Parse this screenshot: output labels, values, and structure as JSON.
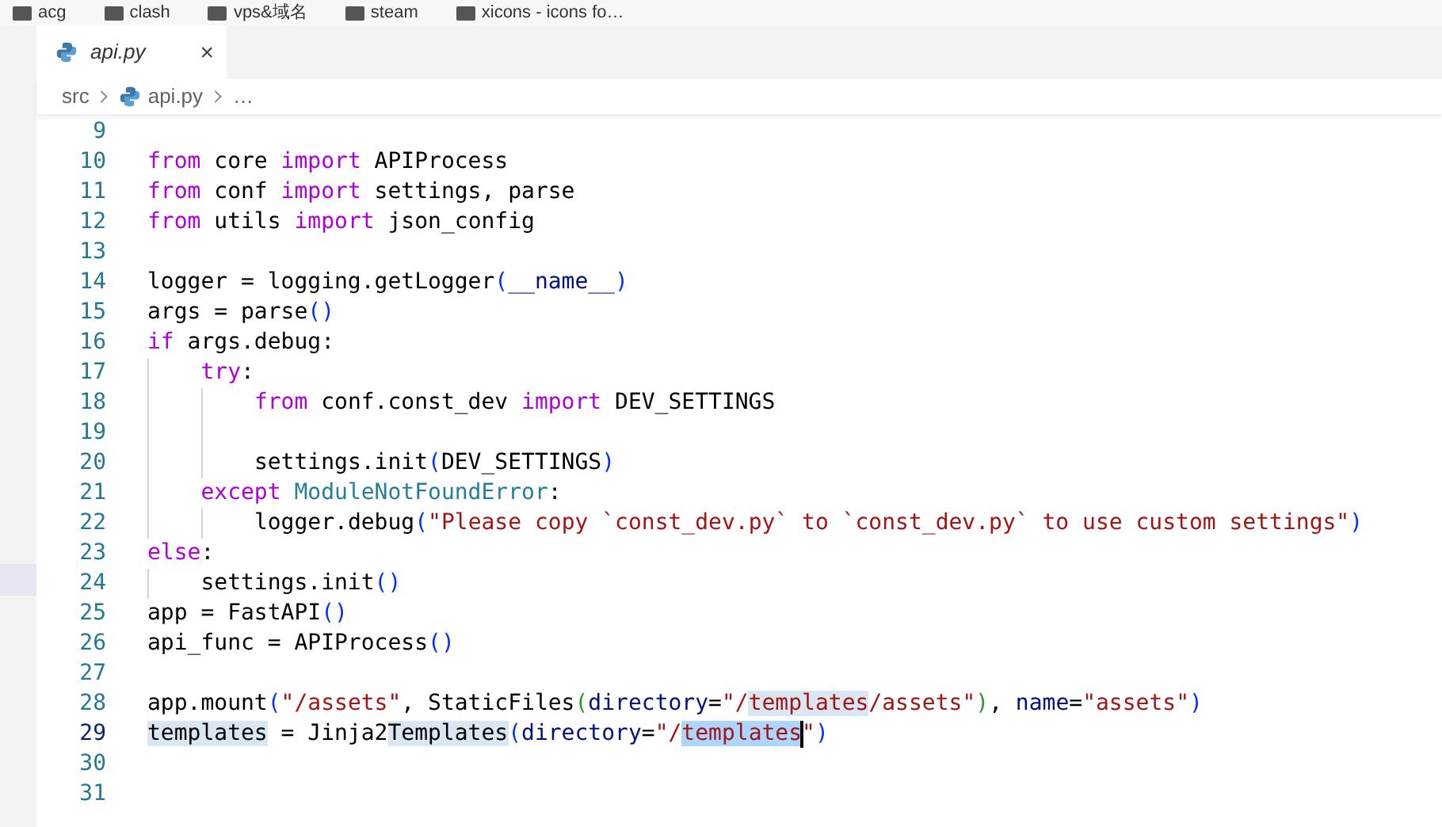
{
  "bookmarks": [
    {
      "label": "acg"
    },
    {
      "label": "clash"
    },
    {
      "label": "vps&域名"
    },
    {
      "label": "steam"
    },
    {
      "label": "xicons - icons fo…"
    }
  ],
  "tabs": [
    {
      "label": "api.py",
      "selected": true,
      "preview": true,
      "close": "×"
    }
  ],
  "breadcrumb": [
    {
      "label": "src",
      "kind": "folder"
    },
    {
      "label": "api.py",
      "kind": "file"
    },
    {
      "label": "…",
      "kind": "more"
    }
  ],
  "editor": {
    "lines": [
      {
        "number": "9",
        "current": false
      },
      {
        "number": "10",
        "current": false,
        "tokens": [
          {
            "t": "from",
            "kind": "kw"
          },
          {
            "t": " core ",
            "kind": "plain"
          },
          {
            "t": "import",
            "kind": "kw"
          },
          {
            "t": " APIProcess",
            "kind": "plain"
          }
        ]
      },
      {
        "number": "11",
        "current": false,
        "tokens": [
          {
            "t": "from",
            "kind": "kw"
          },
          {
            "t": " conf ",
            "kind": "plain"
          },
          {
            "t": "import",
            "kind": "kw"
          },
          {
            "t": " settings, parse",
            "kind": "plain"
          }
        ]
      },
      {
        "number": "12",
        "current": false,
        "tokens": [
          {
            "t": "from",
            "kind": "kw"
          },
          {
            "t": " utils ",
            "kind": "plain"
          },
          {
            "t": "import",
            "kind": "kw"
          },
          {
            "t": " json_config",
            "kind": "plain"
          }
        ]
      },
      {
        "number": "13",
        "current": false
      },
      {
        "number": "14",
        "current": false,
        "tokens": [
          {
            "t": "logger = logging.getLogger",
            "kind": "plain"
          },
          {
            "t": "(",
            "kind": "p1"
          },
          {
            "t": "__name__",
            "kind": "param"
          },
          {
            "t": ")",
            "kind": "p1"
          }
        ]
      },
      {
        "number": "15",
        "current": false,
        "tokens": [
          {
            "t": "args = parse",
            "kind": "plain"
          },
          {
            "t": "()",
            "kind": "p1"
          }
        ]
      },
      {
        "number": "16",
        "current": false,
        "tokens": [
          {
            "t": "if",
            "kind": "kw"
          },
          {
            "t": " args.debug:",
            "kind": "plain"
          }
        ],
        "children": [
          {
            "number": "17",
            "current": false,
            "tokens": [
              {
                "t": "try",
                "kind": "kw"
              },
              {
                "t": ":",
                "kind": "plain"
              }
            ],
            "children": [
              {
                "number": "18",
                "current": false,
                "tokens": [
                  {
                    "t": "from",
                    "kind": "kw"
                  },
                  {
                    "t": " conf.const_dev ",
                    "kind": "plain"
                  },
                  {
                    "t": "import",
                    "kind": "kw"
                  },
                  {
                    "t": " DEV_SETTINGS",
                    "kind": "plain"
                  }
                ]
              },
              {
                "number": "19",
                "current": false
              },
              {
                "number": "20",
                "current": false,
                "tokens": [
                  {
                    "t": "settings.init",
                    "kind": "plain"
                  },
                  {
                    "t": "(",
                    "kind": "p1"
                  },
                  {
                    "t": "DEV_SETTINGS",
                    "kind": "plain"
                  },
                  {
                    "t": ")",
                    "kind": "p1"
                  }
                ]
              }
            ]
          },
          {
            "number": "21",
            "current": false,
            "tokens": [
              {
                "t": "except",
                "kind": "kw"
              },
              {
                "t": " ModuleNotFoundError",
                "kind": "cls"
              },
              {
                "t": ":",
                "kind": "plain"
              }
            ],
            "children": [
              {
                "number": "22",
                "current": false,
                "tokens": [
                  {
                    "t": "logger.debug",
                    "kind": "plain"
                  },
                  {
                    "t": "(",
                    "kind": "p1"
                  },
                  {
                    "t": "\"Please copy `const_dev.py` to `const_dev.py` to use custom settings\"",
                    "kind": "str"
                  },
                  {
                    "t": ")",
                    "kind": "p1"
                  }
                ]
              }
            ]
          }
        ]
      },
      {
        "number": "23",
        "current": false,
        "tokens": [
          {
            "t": "else",
            "kind": "kw"
          },
          {
            "t": ":",
            "kind": "plain"
          }
        ],
        "children": [
          {
            "number": "24",
            "current": false,
            "tokens": [
              {
                "t": "settings.init",
                "kind": "plain"
              },
              {
                "t": "()",
                "kind": "p1"
              }
            ]
          }
        ]
      },
      {
        "number": "25",
        "current": false,
        "tokens": [
          {
            "t": "app = FastAPI",
            "kind": "plain"
          },
          {
            "t": "()",
            "kind": "p1"
          }
        ]
      },
      {
        "number": "26",
        "current": false,
        "tokens": [
          {
            "t": "api_func = APIProcess",
            "kind": "plain"
          },
          {
            "t": "()",
            "kind": "p1"
          }
        ]
      },
      {
        "number": "27",
        "current": false
      },
      {
        "number": "28",
        "current": false,
        "tokens": [
          {
            "t": "app.mount",
            "kind": "plain"
          },
          {
            "t": "(",
            "kind": "p1"
          },
          {
            "t": "\"/assets\"",
            "kind": "str"
          },
          {
            "t": ", StaticFiles",
            "kind": "plain"
          },
          {
            "t": "(",
            "kind": "p2"
          },
          {
            "t": "directory",
            "kind": "param"
          },
          {
            "t": "=",
            "kind": "plain"
          },
          {
            "t": "\"/",
            "kind": "str"
          },
          {
            "t": "templates",
            "kind": "str",
            "match_highlight": true
          },
          {
            "t": "/assets\"",
            "kind": "str"
          },
          {
            "t": ")",
            "kind": "p2"
          },
          {
            "t": ", ",
            "kind": "plain"
          },
          {
            "t": "name",
            "kind": "param"
          },
          {
            "t": "=",
            "kind": "plain"
          },
          {
            "t": "\"assets\"",
            "kind": "str"
          },
          {
            "t": ")",
            "kind": "p1"
          }
        ]
      },
      {
        "number": "29",
        "current": true,
        "tokens": [
          {
            "t": "templates",
            "kind": "plain",
            "match_highlight": true
          },
          {
            "t": " = Jinja2",
            "kind": "plain"
          },
          {
            "t": "Templates",
            "kind": "plain",
            "match_highlight": true
          },
          {
            "t": "(",
            "kind": "p1"
          },
          {
            "t": "directory",
            "kind": "param"
          },
          {
            "t": "=",
            "kind": "plain"
          },
          {
            "t": "\"/",
            "kind": "str"
          },
          {
            "t": "templates",
            "kind": "str",
            "text_selected": true,
            "cursor": true
          },
          {
            "t": "\"",
            "kind": "str"
          },
          {
            "t": ")",
            "kind": "p1"
          }
        ]
      },
      {
        "number": "30",
        "current": false
      },
      {
        "number": "31",
        "current": false
      }
    ]
  }
}
